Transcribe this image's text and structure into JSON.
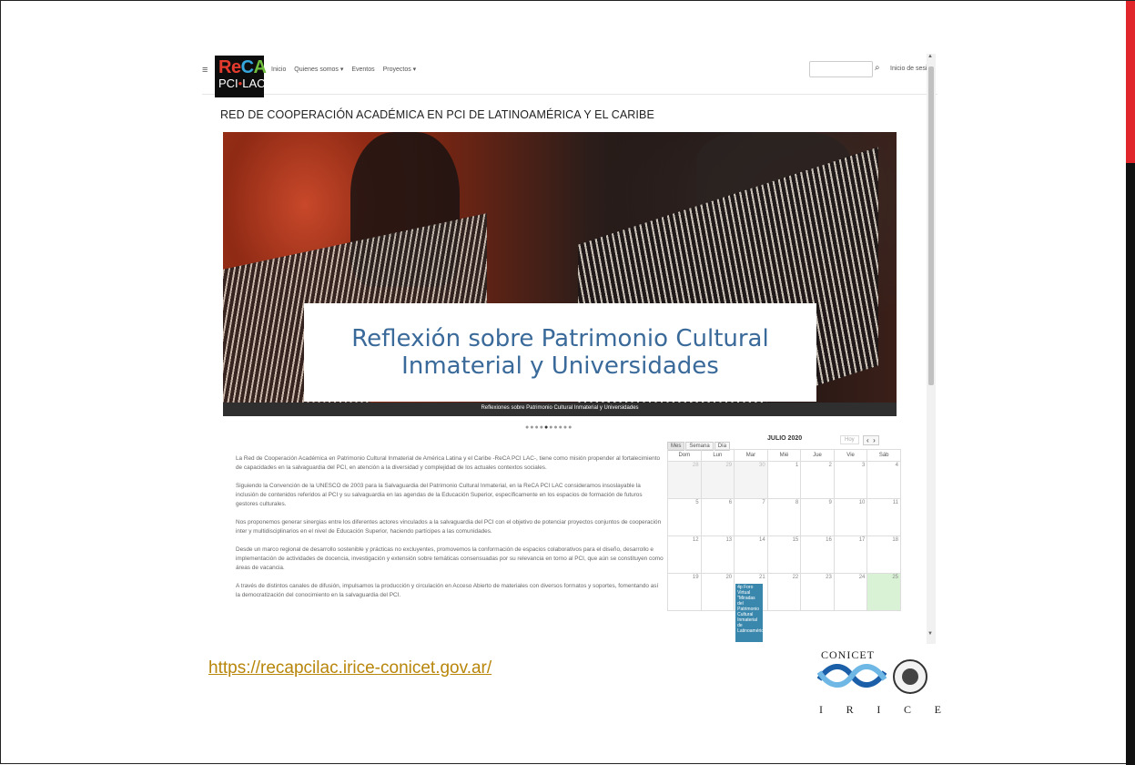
{
  "window": {
    "nav_items": [
      "Inicio",
      "Quienes somos ▾",
      "Eventos",
      "Proyectos ▾"
    ],
    "login_label": "Inicio de sesión",
    "logo": {
      "line1_parts": [
        "Re",
        "C",
        "A"
      ],
      "line2_a": "PCI",
      "line2_dot": "•",
      "line2_b": "LAC"
    }
  },
  "page": {
    "title": "RED DE COOPERACIÓN ACADÉMICA EN PCI DE LATINOAMÉRICA Y EL CARIBE",
    "hero_caption": "Reflexión sobre Patrimonio Cultural Inmaterial y Universidades",
    "hero_strip": "Reflexiones sobre Patrimonio Cultural Inmaterial y Universidades",
    "carousel": {
      "total": 10,
      "active": 4
    },
    "paragraphs": [
      "La Red de Cooperación Académica en Patrimonio Cultural Inmaterial de América Latina y el Caribe -ReCA PCI LAC-, tiene como misión propender al fortalecimiento de capacidades en la salvaguardia del PCI, en atención a la diversidad y complejidad de los actuales contextos sociales.",
      "Siguiendo la Convención de la UNESCO de 2003 para la Salvaguardia del Patrimonio Cultural Inmaterial, en la ReCA PCI LAC consideramos insoslayable la inclusión de contenidos referidos al PCI y su salvaguardia en las agendas de la Educación Superior, específicamente en los espacios de formación de futuros gestores culturales.",
      "Nos proponemos generar sinergias entre los diferentes actores vinculados a la salvaguardia del PCI con el objetivo de potenciar proyectos conjuntos de cooperación inter y multidisciplinarios en el nivel de Educación Superior, haciendo partícipes a las comunidades.",
      "Desde un marco regional de desarrollo sostenible y prácticas no excluyentes, promovemos la conformación de espacios colaborativos para el diseño, desarrollo e implementación de actividades de docencia, investigación y extensión sobre temáticas consensuadas por su relevancia en torno al PCI, que aún se constituyen como áreas de vacancia.",
      "A través de distintos canales de difusión, impulsamos la producción y circulación en Acceso Abierto de materiales con diversos formatos y soportes, fomentando así la democratización del conocimiento en la salvaguardia del PCI."
    ]
  },
  "calendar": {
    "views": [
      "Mes",
      "Semana",
      "Día"
    ],
    "active_view": "Mes",
    "month_label": "JULIO 2020",
    "today_label": "Hoy",
    "prev": "‹",
    "next": "›",
    "weekdays": [
      "Dom",
      "Lun",
      "Mar",
      "Mié",
      "Jue",
      "Vie",
      "Sáb"
    ],
    "weeks": [
      [
        "28",
        "29",
        "30",
        "1",
        "2",
        "3",
        "4"
      ],
      [
        "5",
        "6",
        "7",
        "8",
        "9",
        "10",
        "11"
      ],
      [
        "12",
        "13",
        "14",
        "15",
        "16",
        "17",
        "18"
      ],
      [
        "19",
        "20",
        "21",
        "22",
        "23",
        "24",
        "25"
      ]
    ],
    "event": {
      "time": "4p",
      "text": "Foro Virtual \"Miradas del Patrimonio Cultural Inmaterial de Latinoamérica"
    }
  },
  "slide": {
    "url": "https://recapcilac.irice-conicet.gov.ar/",
    "conicet_label": "CONICET",
    "irice_letters": [
      "I",
      "R",
      "I",
      "C",
      "E"
    ]
  },
  "colors": {
    "accent_red": "#e0262b",
    "accent_black": "#111111",
    "link": "#b8860b",
    "caption_blue": "#3a6a9a",
    "event_blue": "#3a87ad",
    "today_green": "#d9f2d5"
  }
}
